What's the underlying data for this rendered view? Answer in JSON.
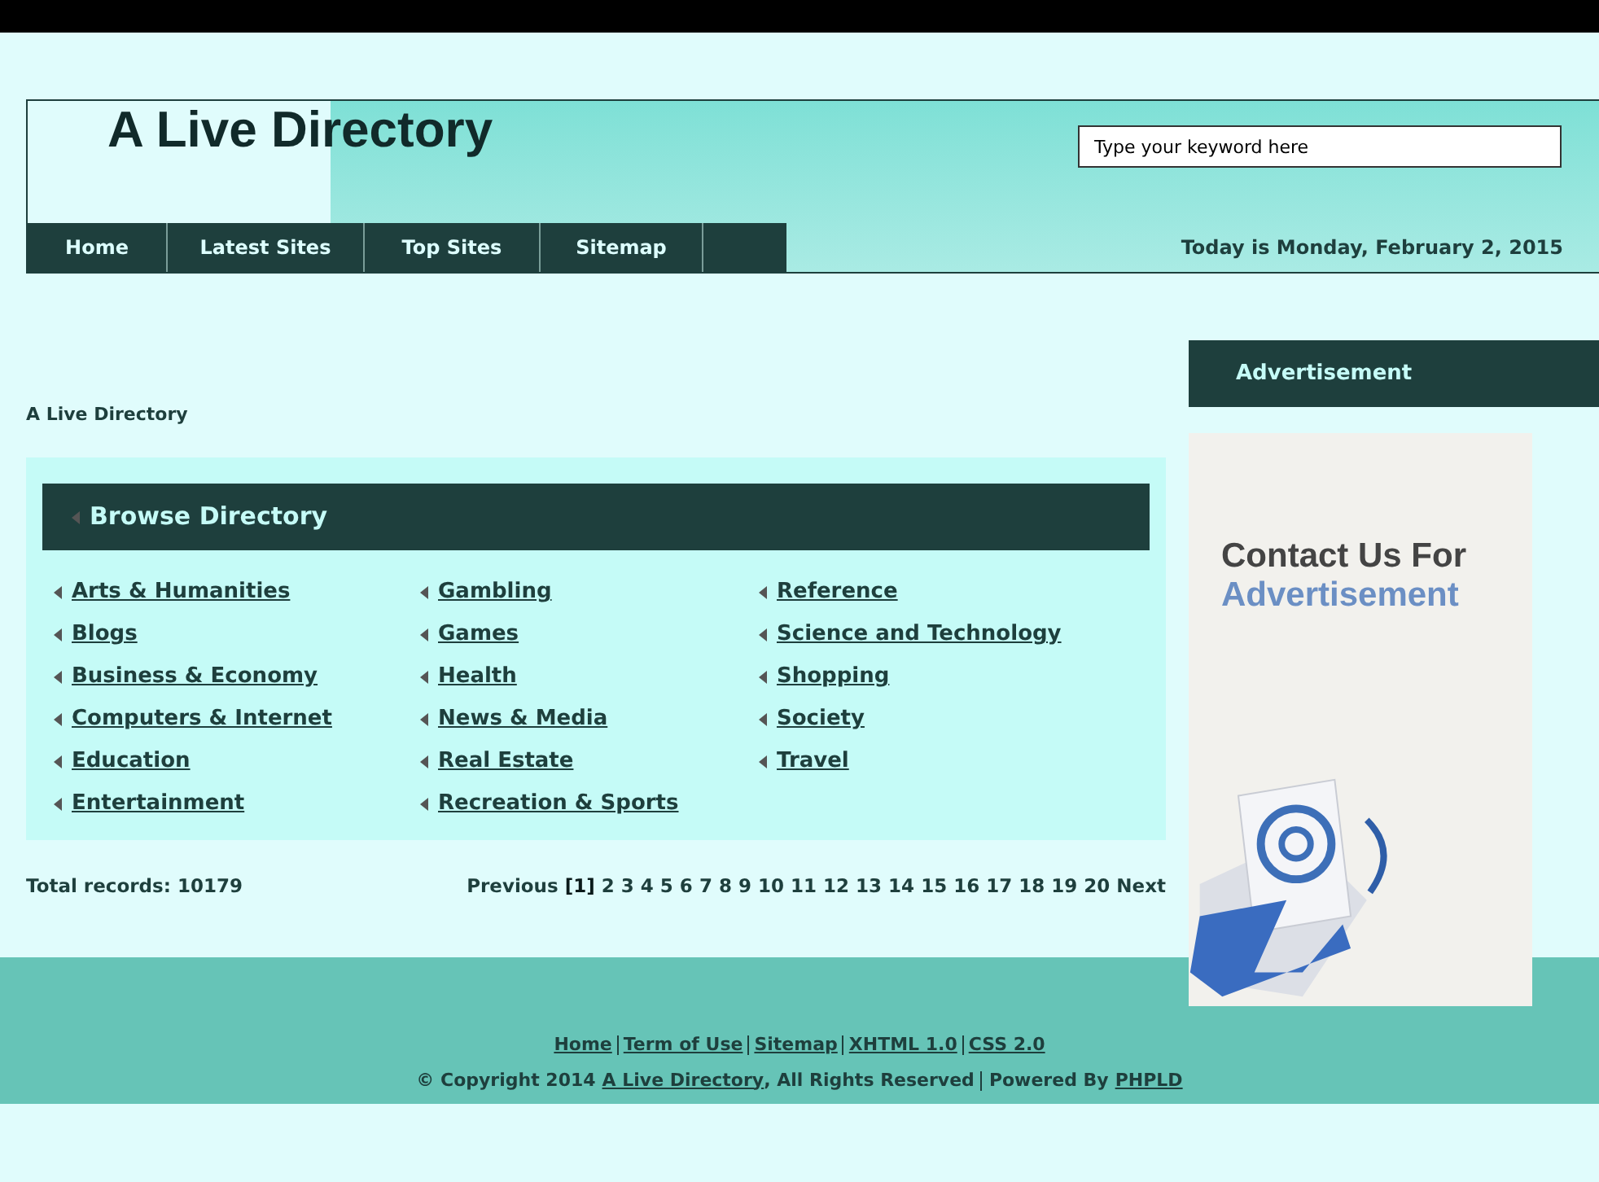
{
  "header": {
    "title": "A Live Directory",
    "search": {
      "placeholder": "Type your keyword here"
    },
    "date": "Today is Monday, February 2, 2015"
  },
  "nav": [
    "Home",
    "Latest Sites",
    "Top Sites",
    "Sitemap"
  ],
  "breadcrumb": "A Live Directory",
  "browse": {
    "title": "Browse Directory",
    "columns": [
      [
        "Arts & Humanities",
        "Blogs",
        "Business & Economy",
        "Computers & Internet",
        "Education",
        "Entertainment"
      ],
      [
        "Gambling",
        "Games",
        "Health",
        "News & Media",
        "Real Estate",
        "Recreation & Sports"
      ],
      [
        "Reference",
        "Science and Technology",
        "Shopping",
        "Society",
        "Travel"
      ]
    ]
  },
  "total_records": "Total records: 10179",
  "pagination": {
    "previous": "Previous",
    "pages": [
      {
        "label": "[1]",
        "selected": true
      },
      {
        "label": "2",
        "selected": false
      },
      {
        "label": "3",
        "selected": false
      },
      {
        "label": "4",
        "selected": false
      },
      {
        "label": "5",
        "selected": false
      },
      {
        "label": "6",
        "selected": false
      },
      {
        "label": "7",
        "selected": false
      },
      {
        "label": "8",
        "selected": false
      },
      {
        "label": "9",
        "selected": false
      },
      {
        "label": "10",
        "selected": false
      },
      {
        "label": "11",
        "selected": false
      },
      {
        "label": "12",
        "selected": false
      },
      {
        "label": "13",
        "selected": false
      },
      {
        "label": "14",
        "selected": false
      },
      {
        "label": "15",
        "selected": false
      },
      {
        "label": "16",
        "selected": false
      },
      {
        "label": "17",
        "selected": false
      },
      {
        "label": "18",
        "selected": false
      },
      {
        "label": "19",
        "selected": false
      },
      {
        "label": "20",
        "selected": false
      }
    ],
    "next": "Next"
  },
  "sidebar": {
    "title": "Advertisement",
    "ad": {
      "line1": "Contact Us For",
      "line2": "Advertisement"
    }
  },
  "footer": {
    "links": [
      "Home",
      "Term of Use",
      "Sitemap",
      "XHTML 1.0",
      "CSS 2.0"
    ],
    "copyright_prefix": "© Copyright 2014",
    "site_link": "A Live Directory",
    "rights": ", All Rights Reserved",
    "powered_by": "Powered By",
    "powered_link": "PHPLD"
  }
}
